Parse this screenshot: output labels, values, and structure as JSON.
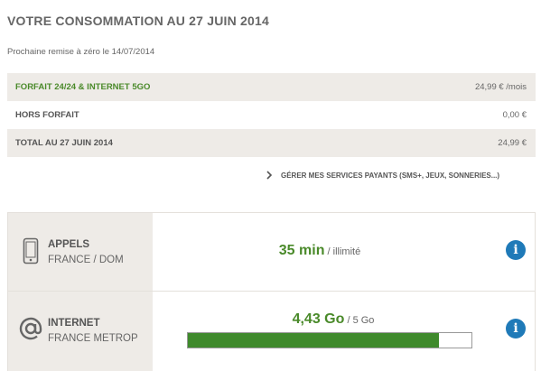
{
  "header": {
    "title": "VOTRE CONSOMMATION AU 27 JUIN 2014",
    "reset_note": "Prochaine remise à zéro le 14/07/2014"
  },
  "summary": [
    {
      "label": "FORFAIT 24/24 & INTERNET 5GO",
      "value": "24,99 € /mois"
    },
    {
      "label": "HORS FORFAIT",
      "value": "0,00 €"
    },
    {
      "label": "TOTAL AU 27 JUIN 2014",
      "value": "24,99 €"
    }
  ],
  "manage_link": {
    "label": "GÉRER MES SERVICES PAYANTS (SMS+, JEUX, SONNERIES...)",
    "icon": "chevron-right-icon"
  },
  "usage": {
    "calls": {
      "icon": "phone-icon",
      "title": "APPELS",
      "subtitle": "FRANCE / DOM",
      "used": "35 min",
      "limit": "/ illimité",
      "info_icon": "info-icon"
    },
    "internet": {
      "icon": "at-sign-icon",
      "title": "INTERNET",
      "subtitle": "FRANCE METROP",
      "used": "4,43 Go",
      "limit": "/ 5 Go",
      "progress_fraction": 0.886,
      "info_icon": "info-icon"
    }
  },
  "colors": {
    "accent_green": "#4a8a2a",
    "bar_green": "#3f8a2c",
    "info_blue": "#1f7ab8",
    "shaded_bg": "#eeebe7"
  }
}
